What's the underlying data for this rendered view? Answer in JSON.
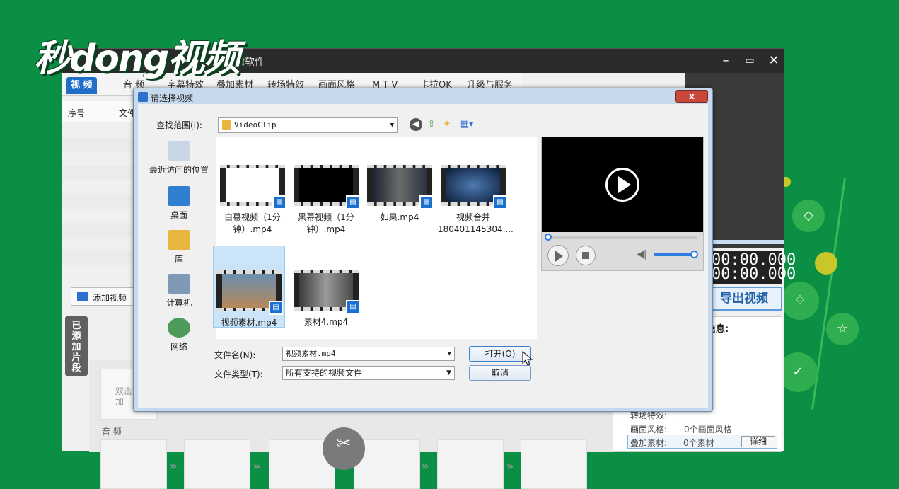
{
  "watermark": {
    "text": "秒dong视频"
  },
  "app": {
    "title": "剪辑软件",
    "tabs": [
      {
        "label": "视 频"
      },
      {
        "label": "音 频"
      },
      {
        "label": "字幕特效"
      },
      {
        "label": "叠加素材"
      },
      {
        "label": "转场特效"
      },
      {
        "label": "画面风格"
      },
      {
        "label": "M T V"
      },
      {
        "label": "卡拉OK"
      },
      {
        "label": "升级与服务"
      }
    ],
    "list_headers": {
      "index": "序号",
      "file": "文件"
    },
    "add_video_label": "添加视频",
    "added_clips_label": "已添加片段",
    "timeline_hint": "双击添加",
    "audio_label": "音 频",
    "time_start": "00:00.000",
    "time_end": "00:00.000",
    "export_label": "导出视频",
    "info_title": "信息:",
    "info_rows": [
      {
        "label": "转场特效:",
        "value": ""
      },
      {
        "label": "画面风格:",
        "value": "0个画面风格"
      },
      {
        "label": "叠加素材:",
        "value": "0个素材"
      }
    ],
    "detail_button": "详细"
  },
  "dialog": {
    "title": "请选择视频",
    "close_label": "x",
    "look_in_label": "查找范围(I):",
    "look_in_value": "VideoClip",
    "places": [
      {
        "label": "最近访问的位置",
        "icon": "recent-icon"
      },
      {
        "label": "桌面",
        "icon": "desktop-icon"
      },
      {
        "label": "库",
        "icon": "library-icon"
      },
      {
        "label": "计算机",
        "icon": "computer-icon"
      },
      {
        "label": "网络",
        "icon": "network-icon"
      }
    ],
    "files": [
      {
        "name_line1": "白幕视频（1分",
        "name_line2": "钟）.mp4"
      },
      {
        "name_line1": "黑幕视频（1分",
        "name_line2": "钟）.mp4"
      },
      {
        "name_line1": "如果.mp4",
        "name_line2": ""
      },
      {
        "name_line1": "视频合并",
        "name_line2": "180401145304...."
      },
      {
        "name_line1": "视频素材.mp4",
        "name_line2": ""
      },
      {
        "name_line1": "素材4.mp4",
        "name_line2": ""
      }
    ],
    "file_name_label": "文件名(N):",
    "file_name_value": "视频素材.mp4",
    "file_type_label": "文件类型(T):",
    "file_type_value": "所有支持的视频文件",
    "open_label": "打开(O)",
    "cancel_label": "取消"
  },
  "colors": {
    "background": "#0a8f45",
    "accent": "#1f6fc9",
    "export_text": "#1f5fa8"
  }
}
